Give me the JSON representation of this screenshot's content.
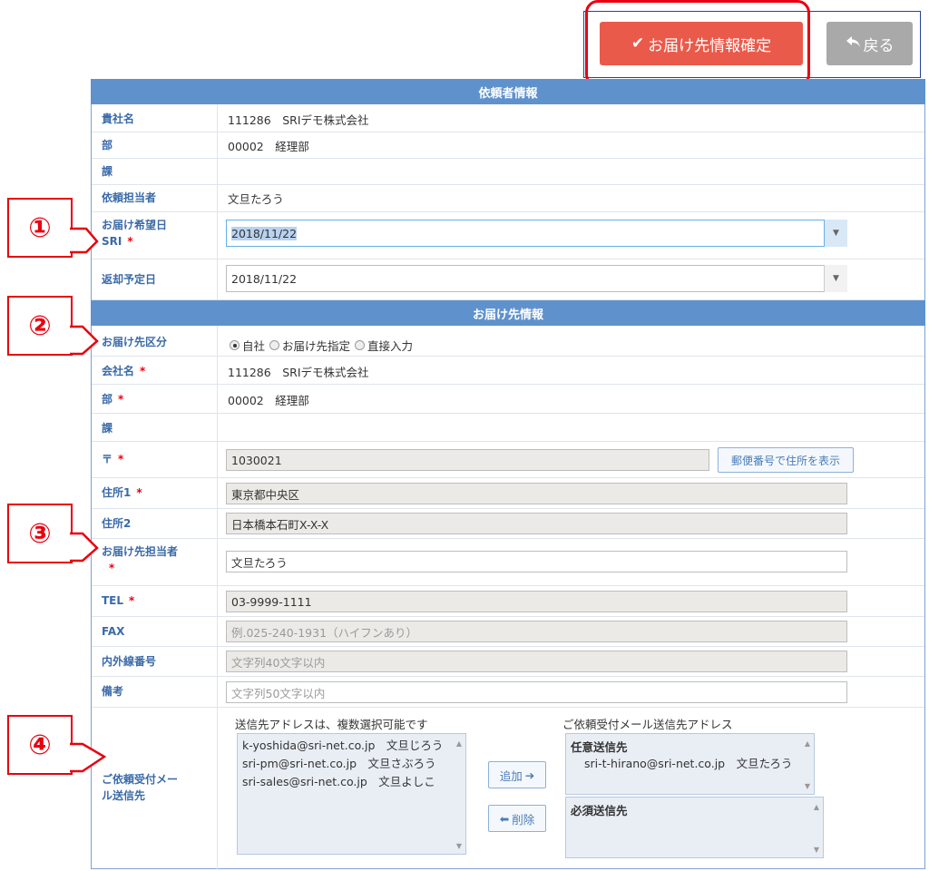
{
  "toolbar": {
    "confirm_label": "お届け先情報確定",
    "back_label": "戻る"
  },
  "requester": {
    "section_title": "依頼者情報",
    "company_label": "貴社名",
    "company_value": "111286　SRIデモ株式会社",
    "dept_label": "部",
    "dept_value": "00002　経理部",
    "section_label": "課",
    "section_value": "",
    "person_label": "依頼担当者",
    "person_value": "文旦たろう",
    "delivery_date_label_line1": "お届け希望日",
    "delivery_date_label_line2": "SRI",
    "delivery_date_value": "2018/11/22",
    "return_date_label": "返却予定日",
    "return_date_value": "2018/11/22"
  },
  "delivery": {
    "section_title": "お届け先情報",
    "type_label": "お届け先区分",
    "type_options": [
      "自社",
      "お届け先指定",
      "直接入力"
    ],
    "type_selected": "自社",
    "company_label": "会社名",
    "company_value": "111286　SRIデモ株式会社",
    "dept_label": "部",
    "dept_value": "00002　経理部",
    "section_label": "課",
    "section_value": "",
    "zip_label": "〒",
    "zip_value": "1030021",
    "zip_button": "郵便番号で住所を表示",
    "addr1_label": "住所1",
    "addr1_value": "東京都中央区",
    "addr2_label": "住所2",
    "addr2_value": "日本橋本石町X-X-X",
    "contact_label": "お届け先担当者",
    "contact_value": "文旦たろう",
    "tel_label": "TEL",
    "tel_value": "03-9999-1111",
    "fax_label": "FAX",
    "fax_placeholder": "例.025-240-1931（ハイフンあり）",
    "ext_label": "内外線番号",
    "ext_placeholder": "文字列40文字以内",
    "note_label": "備考",
    "note_placeholder": "文字列50文字以内",
    "required_mark": "*"
  },
  "mail": {
    "label_line1": "ご依頼受付メー",
    "label_line2": "ル送信先",
    "source_caption": "送信先アドレスは、複数選択可能です",
    "source_items": [
      "k-yoshida@sri-net.co.jp　文旦じろう",
      "sri-pm@sri-net.co.jp　文旦さぶろう",
      "sri-sales@sri-net.co.jp　文旦よしこ"
    ],
    "add_button": "追加",
    "remove_button": "削除",
    "dest_caption": "ご依頼受付メール送信先アドレス",
    "optional_header": "任意送信先",
    "optional_items": [
      "sri-t-hirano@sri-net.co.jp　文旦たろう"
    ],
    "required_header": "必須送信先"
  },
  "callouts": [
    "①",
    "②",
    "③",
    "④"
  ],
  "colors": {
    "section_header": "#5f92cc",
    "label": "#3a6aa8",
    "confirm_button": "#ea5a4a",
    "back_button": "#a9a9a9",
    "highlight": "#e8000f"
  }
}
